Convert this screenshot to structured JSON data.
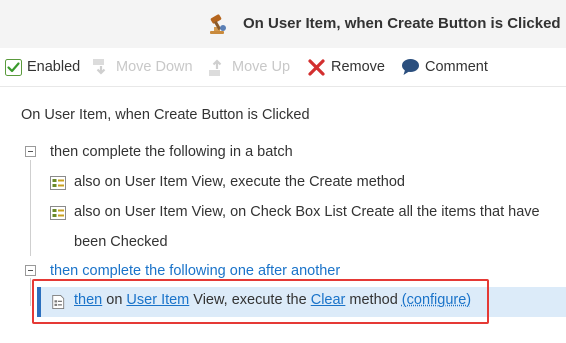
{
  "header": {
    "title": "On User Item, when Create Button is Clicked",
    "icon": "rule-gavel-icon"
  },
  "toolbar": {
    "enabled_label": "Enabled",
    "enabled_checked": true,
    "move_down_label": "Move Down",
    "move_up_label": "Move Up",
    "remove_label": "Remove",
    "comment_label": "Comment"
  },
  "rule": {
    "heading": "On User Item, when Create Button is Clicked",
    "batch_label": "then complete the following in a batch",
    "batch_items": [
      {
        "text": "also on User Item View, execute the Create method",
        "icon": "method-icon"
      },
      {
        "text_line1": "also on User Item View, on Check Box List Create all the items that have",
        "text_line2": "been Checked",
        "icon": "method-icon"
      }
    ],
    "sequence_label": "then complete the following one after another",
    "selected_item": {
      "prefix": "then",
      "part1": " on ",
      "target": "User Item",
      "part2": " View, execute the ",
      "method": "Clear",
      "part3": " method ",
      "configure": "(configure)"
    }
  },
  "colors": {
    "accent": "#2b6fbe",
    "link": "#1a73c9",
    "highlight": "#e53935",
    "selected_bg": "#dcebf9"
  }
}
